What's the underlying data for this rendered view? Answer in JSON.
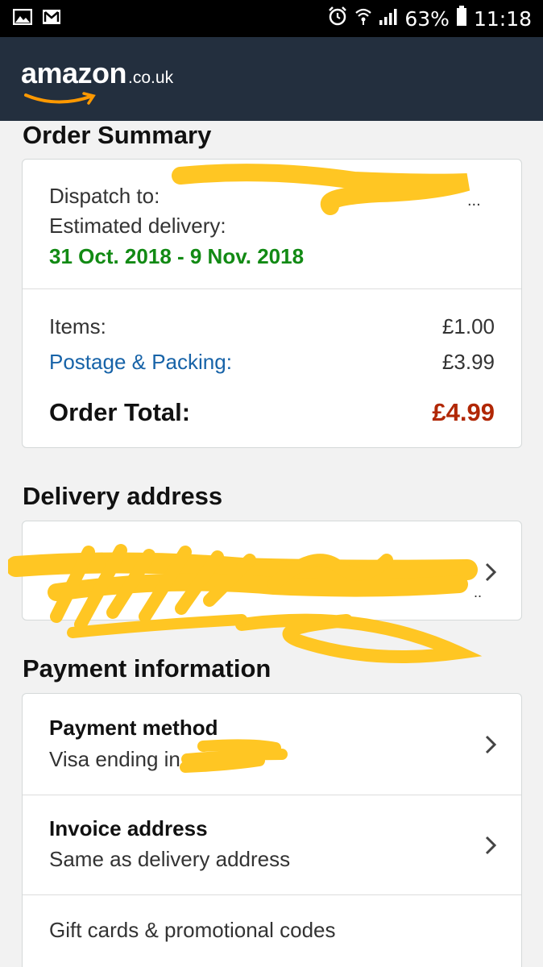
{
  "status_bar": {
    "battery": "63%",
    "time": "11:18",
    "icons": [
      "gallery-icon",
      "gmail-icon",
      "alarm-icon",
      "wifi-icon",
      "signal-icon",
      "battery-icon"
    ]
  },
  "header": {
    "logo_word": "amazon",
    "logo_tld": ".co.uk",
    "background": "#232f3e",
    "smile_color": "#ff9900"
  },
  "order_summary": {
    "title": "Order Summary",
    "dispatch_label": "Dispatch to:",
    "estimated_label": "Estimated delivery:",
    "delivery_range": "31 Oct. 2018 - 9 Nov. 2018",
    "items_label": "Items:",
    "items_value": "£1.00",
    "postage_label": "Postage & Packing:",
    "postage_value": "£3.99",
    "total_label": "Order Total:",
    "total_value": "£4.99",
    "total_color": "#b12704"
  },
  "delivery_address": {
    "title": "Delivery address"
  },
  "payment": {
    "title": "Payment information",
    "method_label": "Payment method",
    "method_value": "Visa ending in",
    "invoice_label": "Invoice address",
    "invoice_value": "Same as delivery address",
    "gift_label": "Gift cards & promotional codes"
  },
  "redaction_color": "#ffc623"
}
